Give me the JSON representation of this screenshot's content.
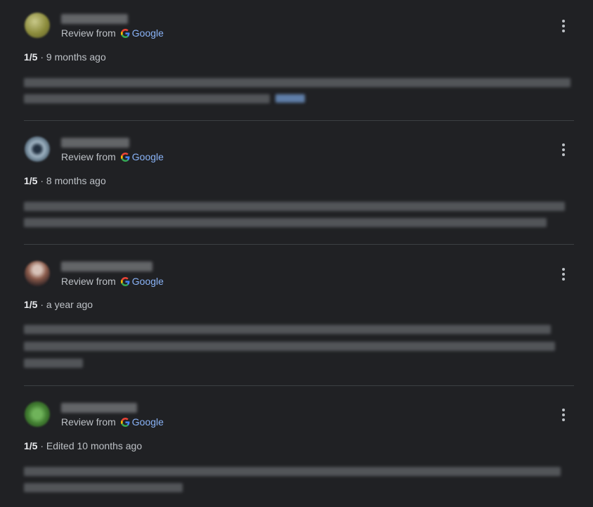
{
  "reviews": [
    {
      "source_label": "Review from",
      "source_name": "Google",
      "score": "1/5",
      "separator": " · ",
      "time": "9 months ago",
      "avatar_colors": [
        "#8a8a3a",
        "#c9c98a",
        "#5a5a2a"
      ],
      "has_more_link": true
    },
    {
      "source_label": "Review from",
      "source_name": "Google",
      "score": "1/5",
      "separator": " · ",
      "time": "8 months ago",
      "avatar_colors": [
        "#5a6f80",
        "#9fb3c2",
        "#223040"
      ],
      "has_more_link": false
    },
    {
      "source_label": "Review from",
      "source_name": "Google",
      "score": "1/5",
      "separator": " · ",
      "time": "a year ago",
      "avatar_colors": [
        "#8a5a4a",
        "#d7c2b8",
        "#3a2a2a"
      ],
      "has_more_link": false
    },
    {
      "source_label": "Review from",
      "source_name": "Google",
      "score": "1/5",
      "separator": " · ",
      "time": "Edited 10 months ago",
      "avatar_colors": [
        "#3f7a2f",
        "#6fb35a",
        "#2a5220"
      ],
      "has_more_link": false
    }
  ],
  "colors": {
    "background": "#202124",
    "google_link": "#8ab4f8",
    "divider": "#3c4043"
  },
  "icons": {
    "menu": "more-vert-icon",
    "google": "google-g-icon"
  }
}
